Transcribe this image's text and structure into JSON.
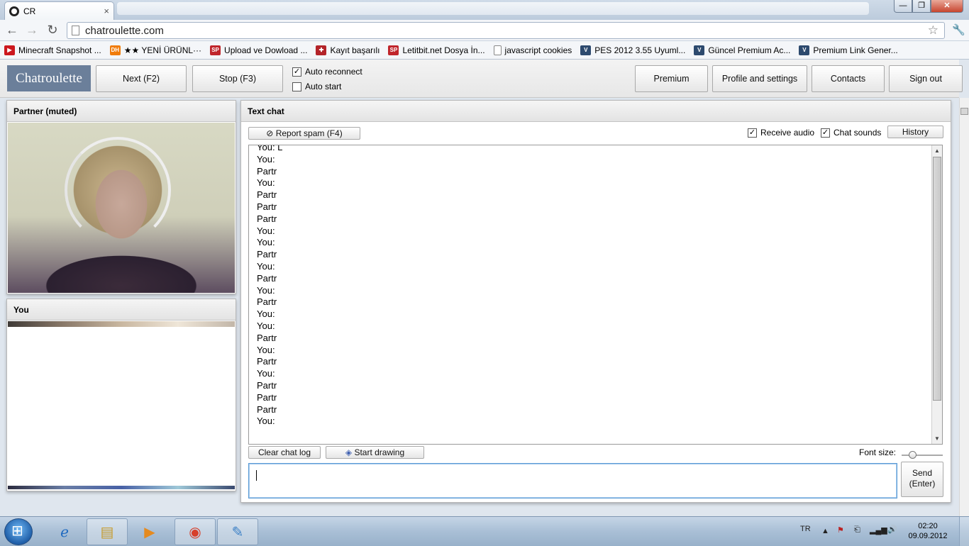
{
  "browser": {
    "tab_title": "CR",
    "tab_close": "×",
    "url": "chatroulette.com",
    "win_min": "—",
    "win_max": "❐",
    "win_close": "✕",
    "back": "←",
    "forward": "→",
    "reload": "↻",
    "star": "☆",
    "wrench": "🔧",
    "bookmarks": [
      {
        "label": "Minecraft Snapshot ...",
        "icon": "youtube-icon",
        "icon_text": "▶",
        "color": "#cc181e"
      },
      {
        "label": "★★ YENİ ÜRÜNL···",
        "icon": "dh-icon",
        "icon_text": "DH",
        "color": "#f07c0a"
      },
      {
        "label": "Upload ve Dowload ...",
        "icon": "sp-icon",
        "icon_text": "SP",
        "color": "#c0262c"
      },
      {
        "label": "Kayıt başarılı",
        "icon": "gift-icon",
        "icon_text": "✚",
        "color": "#b3242a"
      },
      {
        "label": "Letitbit.net Dosya İn...",
        "icon": "sp-icon",
        "icon_text": "SP",
        "color": "#c0262c"
      },
      {
        "label": "javascript cookies",
        "icon": "page-icon",
        "icon_text": "",
        "color": "#ffffff"
      },
      {
        "label": "PES 2012 3.55 Uyuml...",
        "icon": "v-icon",
        "icon_text": "V",
        "color": "#2d4a6e"
      },
      {
        "label": "Güncel Premium Ac...",
        "icon": "v-icon",
        "icon_text": "V",
        "color": "#2d4a6e"
      },
      {
        "label": "Premium Link Gener...",
        "icon": "v-icon",
        "icon_text": "V",
        "color": "#2d4a6e"
      }
    ]
  },
  "appbar": {
    "logo": "Chatroulette",
    "next": "Next (F2)",
    "stop": "Stop (F3)",
    "auto_reconnect": "Auto reconnect",
    "auto_start": "Auto start",
    "premium": "Premium",
    "profile": "Profile and settings",
    "contacts": "Contacts",
    "signout": "Sign out",
    "check_mark": "✓"
  },
  "partner_panel": {
    "title": "Partner (muted)"
  },
  "you_panel": {
    "title": "You"
  },
  "chat": {
    "title": "Text chat",
    "report_spam": "Report spam (F4)",
    "report_icon": "⊘",
    "receive_audio": "Receive audio",
    "chat_sounds": "Chat sounds",
    "history": "History",
    "clear_log": "Clear chat log",
    "start_drawing": "Start drawing",
    "draw_icon": "◈",
    "font_size": "Font size:",
    "send_line1": "Send",
    "send_line2": "(Enter)",
    "lines": [
      "You: L",
      "You:",
      "Partr",
      "You:",
      "Partr",
      "Partr",
      "Partr",
      "You:",
      "You:",
      "Partr",
      "You:",
      "Partr",
      "You:",
      "Partr",
      "You:",
      "You:",
      "Partr",
      "You:",
      "Partr",
      "You:",
      "Partr",
      "Partr",
      "Partr",
      "You:"
    ]
  },
  "taskbar": {
    "lang": "TR",
    "time": "02:20",
    "date": "09.09.2012",
    "tray_icons": [
      "▲",
      "⚑",
      "⎗",
      "▂▄▆",
      "🔊"
    ]
  },
  "colors": {
    "logo_bg": "#6b7f9a",
    "input_focus": "#5b9bd5"
  }
}
